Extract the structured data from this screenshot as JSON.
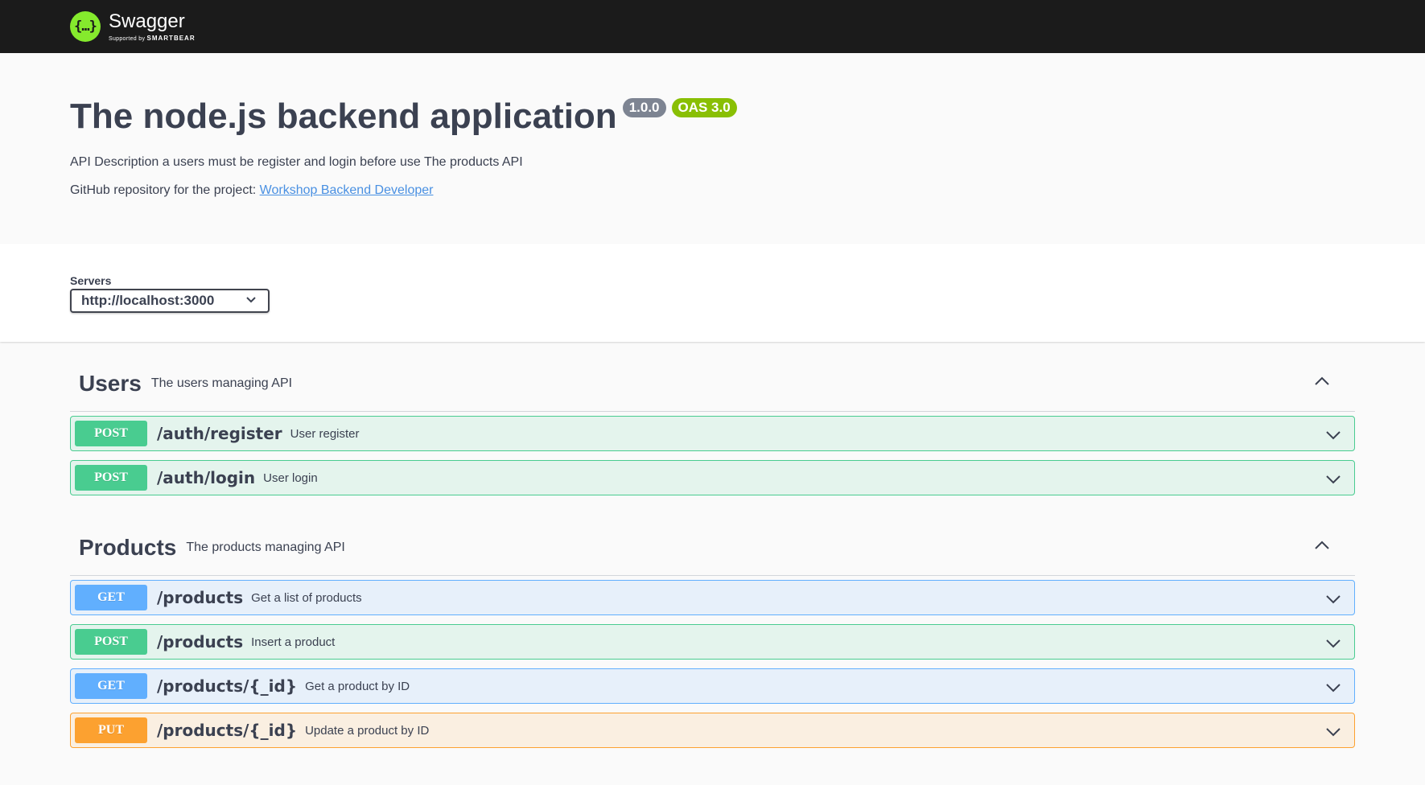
{
  "topbar": {
    "logo_glyph": "{…}",
    "brand_name": "Swagger",
    "brand_sub_prefix": "Supported by",
    "brand_sub_name": "SMARTBEAR"
  },
  "info": {
    "title": "The node.js backend application",
    "version": "1.0.0",
    "oas": "OAS 3.0",
    "description": "API Description a users must be register and login before use The products API",
    "repo_prefix": "GitHub repository for the project: ",
    "repo_link": "Workshop Backend Developer"
  },
  "servers": {
    "label": "Servers",
    "selected": "http://localhost:3000"
  },
  "tags": [
    {
      "name": "Users",
      "description": "The users managing API",
      "operations": [
        {
          "method": "POST",
          "path": "/auth/register",
          "summary": "User register"
        },
        {
          "method": "POST",
          "path": "/auth/login",
          "summary": "User login"
        }
      ]
    },
    {
      "name": "Products",
      "description": "The products managing API",
      "operations": [
        {
          "method": "GET",
          "path": "/products",
          "summary": "Get a list of products"
        },
        {
          "method": "POST",
          "path": "/products",
          "summary": "Insert a product"
        },
        {
          "method": "GET",
          "path": "/products/{_id}",
          "summary": "Get a product by ID"
        },
        {
          "method": "PUT",
          "path": "/products/{_id}",
          "summary": "Update a product by ID"
        }
      ]
    }
  ],
  "colors": {
    "topbar": "#1b1b1b",
    "logo": "#85ea2d",
    "post": "#49cc90",
    "get": "#61affe",
    "put": "#fca130",
    "version_badge": "#7d8492",
    "oas_badge": "#89bf04",
    "link": "#4990e2"
  },
  "icons": {
    "tag_toggle": "chevron-up-icon",
    "op_toggle": "chevron-down-icon",
    "select": "chevron-down-icon"
  }
}
